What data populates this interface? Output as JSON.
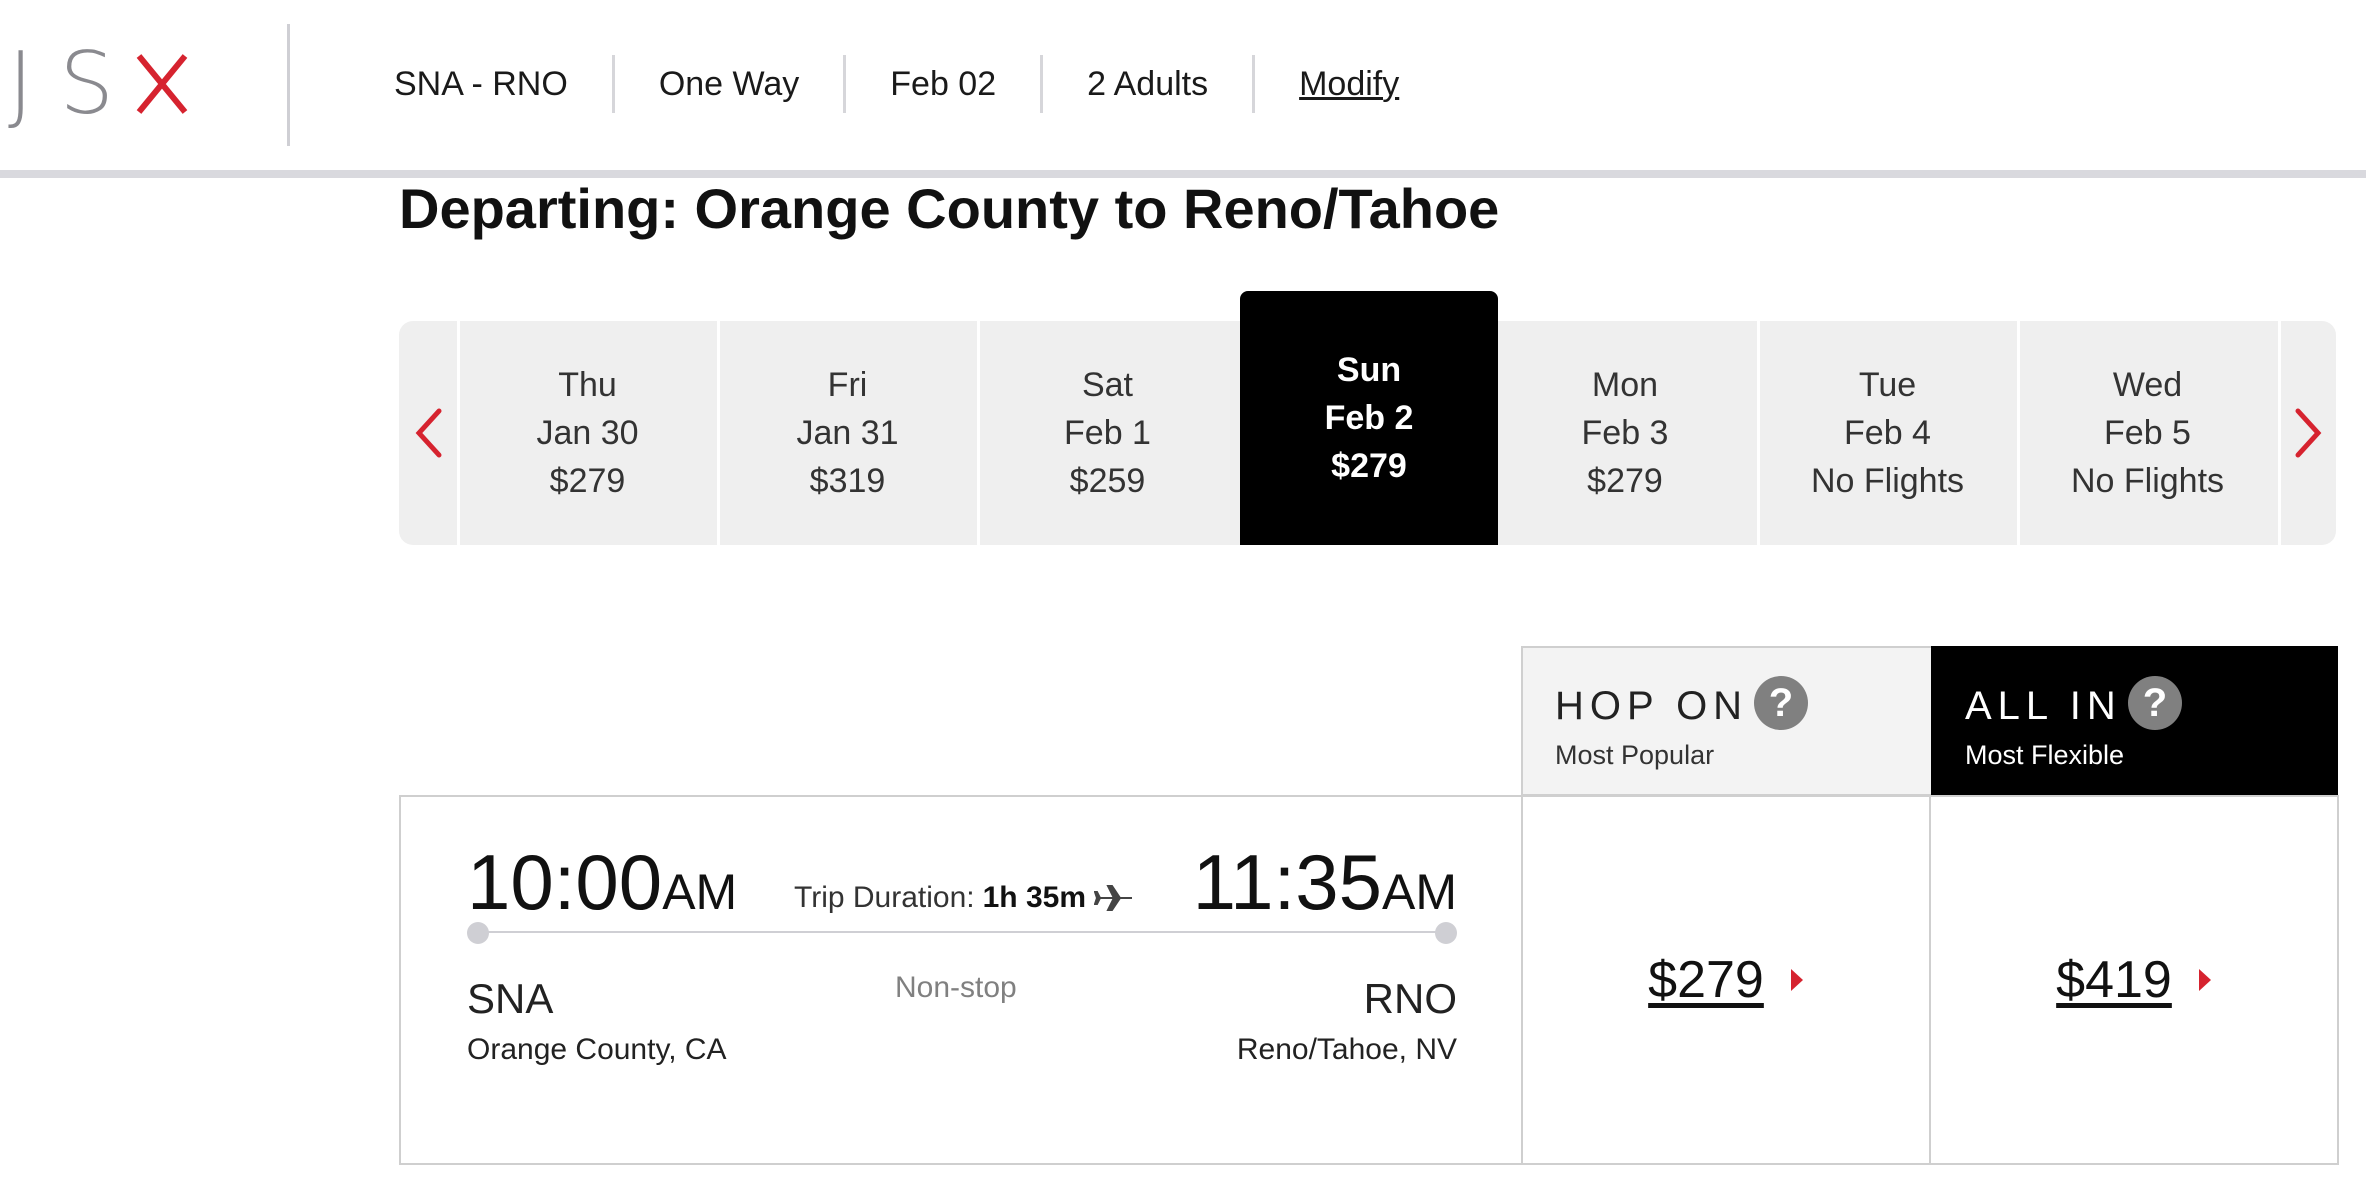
{
  "logo": {
    "letters": [
      "J",
      "S",
      "X"
    ]
  },
  "summary": {
    "route": "SNA - RNO",
    "trip_type": "One Way",
    "date": "Feb 02",
    "passengers": "2 Adults",
    "modify_label": "Modify"
  },
  "page_title": "Departing: Orange County to Reno/Tahoe",
  "date_strip": {
    "days": [
      {
        "weekday": "Thu",
        "date": "Jan 30",
        "price": "$279",
        "selected": false
      },
      {
        "weekday": "Fri",
        "date": "Jan 31",
        "price": "$319",
        "selected": false
      },
      {
        "weekday": "Sat",
        "date": "Feb 1",
        "price": "$259",
        "selected": false
      },
      {
        "weekday": "Sun",
        "date": "Feb 2",
        "price": "$279",
        "selected": true
      },
      {
        "weekday": "Mon",
        "date": "Feb 3",
        "price": "$279",
        "selected": false
      },
      {
        "weekday": "Tue",
        "date": "Feb 4",
        "price": "No Flights",
        "selected": false
      },
      {
        "weekday": "Wed",
        "date": "Feb 5",
        "price": "No Flights",
        "selected": false
      }
    ]
  },
  "fares": {
    "hop_on": {
      "name": "HOP ON",
      "subtitle": "Most Popular",
      "help": "?"
    },
    "all_in": {
      "name": "ALL IN",
      "subtitle": "Most Flexible",
      "help": "?"
    }
  },
  "flight": {
    "depart_time": "10:00",
    "depart_ampm": "AM",
    "arrive_time": "11:35",
    "arrive_ampm": "AM",
    "duration_label": "Trip Duration:",
    "duration_value": "1h 35m",
    "stops": "Non-stop",
    "origin_code": "SNA",
    "origin_city": "Orange County, CA",
    "dest_code": "RNO",
    "dest_city": "Reno/Tahoe, NV",
    "hop_on_price": "$279",
    "all_in_price": "$419"
  },
  "colors": {
    "accent_red": "#d6232f",
    "selected_bg": "#000000",
    "strip_bg": "#efefef",
    "logo_gray": "#8a8a8f"
  },
  "icons": {
    "prev": "chevron-left-icon",
    "next": "chevron-right-icon",
    "plane": "airplane-icon",
    "help": "help-icon",
    "caret": "caret-right-icon"
  }
}
